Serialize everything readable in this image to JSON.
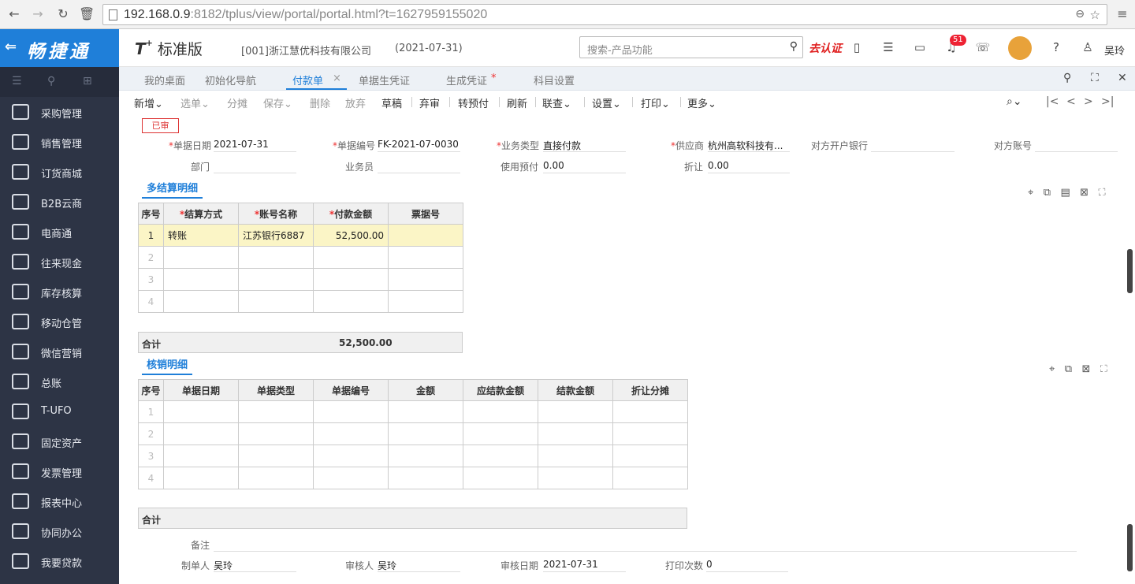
{
  "browser": {
    "url_host": "192.168.0.9",
    "url_rest": ":8182/tplus/view/portal/portal.html?t=1627959155020"
  },
  "app": {
    "logo_text": "畅捷通",
    "brand": "T",
    "brand_sup": "+",
    "edition": "标准版",
    "company": "[001]浙江慧优科技有限公司",
    "date": "(2021-07-31)",
    "search_placeholder": "搜索-产品功能",
    "cert": "去认证",
    "badge": "51",
    "user": "吴玲"
  },
  "sidebar": {
    "items": [
      {
        "label": "采购管理"
      },
      {
        "label": "销售管理"
      },
      {
        "label": "订货商城"
      },
      {
        "label": "B2B云商"
      },
      {
        "label": "电商通"
      },
      {
        "label": "往来现金"
      },
      {
        "label": "库存核算"
      },
      {
        "label": "移动仓管"
      },
      {
        "label": "微信营销"
      },
      {
        "label": "总账"
      },
      {
        "label": "T-UFO"
      },
      {
        "label": "固定资产"
      },
      {
        "label": "发票管理"
      },
      {
        "label": "报表中心"
      },
      {
        "label": "协同办公"
      },
      {
        "label": "我要贷款"
      }
    ]
  },
  "tabs": [
    {
      "label": "我的桌面"
    },
    {
      "label": "初始化导航"
    },
    {
      "label": "付款单"
    },
    {
      "label": "单据生凭证"
    },
    {
      "label": "生成凭证"
    },
    {
      "label": "科目设置"
    }
  ],
  "tab_marks": {
    "close": "×",
    "modified": "*"
  },
  "toolbar": {
    "new": "新增",
    "pick": "选单",
    "split": "分摊",
    "save": "保存",
    "delete": "删除",
    "abandon": "放弃",
    "draft": "草稿",
    "discard": "弃审",
    "prepay": "转预付",
    "refresh": "刷新",
    "link": "联查",
    "settings": "设置",
    "print": "打印",
    "more": "更多"
  },
  "form": {
    "stamp": "已审",
    "date_label": "单据日期",
    "date": "2021-07-31",
    "no_label": "单据编号",
    "no": "FK-2021-07-0030",
    "type_label": "业务类型",
    "type": "直接付款",
    "supplier_label": "供应商",
    "supplier": "杭州高软科技有...",
    "bank_label": "对方开户银行",
    "bank": "",
    "account_label": "对方账号",
    "account": "",
    "dept_label": "部门",
    "dept": "",
    "staff_label": "业务员",
    "staff": "",
    "prepay_label": "使用预付",
    "prepay": "0.00",
    "discount_label": "折让",
    "discount": "0.00"
  },
  "settle": {
    "title": "多结算明细",
    "headers": [
      "序号",
      "结算方式",
      "账号名称",
      "付款金额",
      "票据号"
    ],
    "rows": [
      [
        "1",
        "转账",
        "江苏银行6887",
        "52,500.00",
        ""
      ],
      [
        "2",
        "",
        "",
        "",
        ""
      ],
      [
        "3",
        "",
        "",
        "",
        ""
      ],
      [
        "4",
        "",
        "",
        "",
        ""
      ]
    ],
    "total_label": "合计",
    "total": "52,500.00"
  },
  "writeoff": {
    "title": "核销明细",
    "headers": [
      "序号",
      "单据日期",
      "单据类型",
      "单据编号",
      "金额",
      "应结款金额",
      "结款金额",
      "折让分摊"
    ],
    "rows": [
      [
        "1"
      ],
      [
        "2"
      ],
      [
        "3"
      ],
      [
        "4"
      ]
    ],
    "total_label": "合计"
  },
  "footer": {
    "remark_label": "备注",
    "remark": "",
    "maker_label": "制单人",
    "maker": "吴玲",
    "auditor_label": "审核人",
    "auditor": "吴玲",
    "audit_date_label": "审核日期",
    "audit_date": "2021-07-31",
    "print_label": "打印次数",
    "print_count": "0"
  }
}
